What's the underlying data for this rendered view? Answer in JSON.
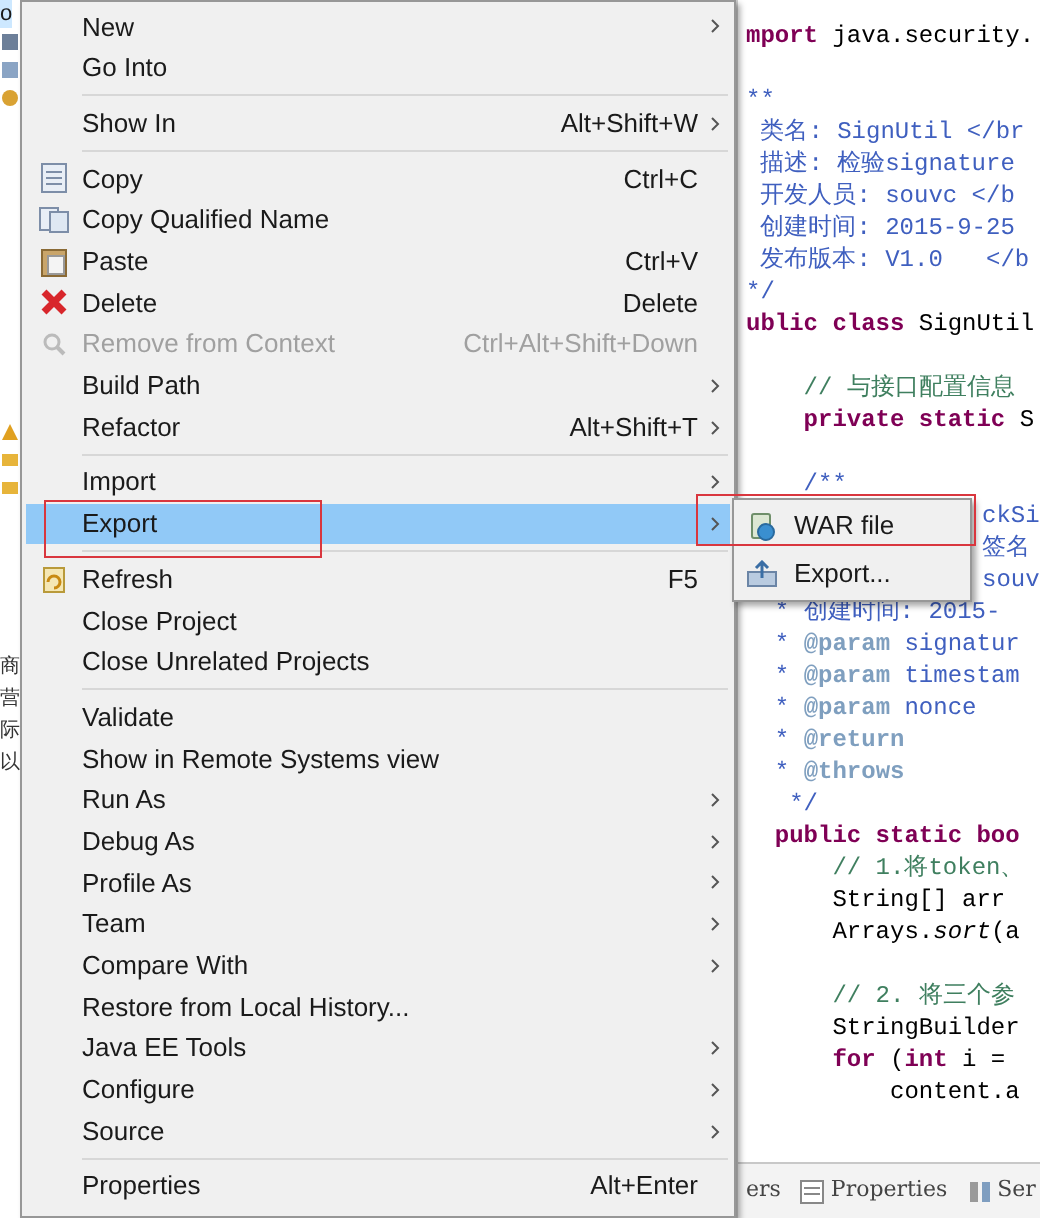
{
  "explorer": {
    "project": "o",
    "side_texts": [
      "商",
      "营",
      "际",
      "以"
    ]
  },
  "context_menu": {
    "groups": [
      [
        {
          "label": "New",
          "submenu": true,
          "disabled": false,
          "selected": false
        },
        {
          "label": "Go Into",
          "submenu": false,
          "disabled": false,
          "selected": false
        }
      ],
      [
        {
          "label": "Show In",
          "shortcut": "Alt+Shift+W",
          "submenu": true,
          "disabled": false,
          "selected": false
        }
      ],
      [
        {
          "label": "Copy",
          "shortcut": "Ctrl+C",
          "submenu": false,
          "disabled": false,
          "selected": false
        },
        {
          "label": "Copy Qualified Name",
          "submenu": false,
          "disabled": false,
          "selected": false
        },
        {
          "label": "Paste",
          "shortcut": "Ctrl+V",
          "submenu": false,
          "disabled": false,
          "selected": false
        },
        {
          "label": "Delete",
          "shortcut": "Delete",
          "submenu": false,
          "disabled": false,
          "selected": false
        },
        {
          "label": "Remove from Context",
          "shortcut": "Ctrl+Alt+Shift+Down",
          "submenu": false,
          "disabled": true,
          "selected": false
        },
        {
          "label": "Build Path",
          "submenu": true,
          "disabled": false,
          "selected": false
        },
        {
          "label": "Refactor",
          "shortcut": "Alt+Shift+T",
          "submenu": true,
          "disabled": false,
          "selected": false
        }
      ],
      [
        {
          "label": "Import",
          "submenu": true,
          "disabled": false,
          "selected": false
        },
        {
          "label": "Export",
          "submenu": true,
          "disabled": false,
          "selected": true
        }
      ],
      [
        {
          "label": "Refresh",
          "shortcut": "F5",
          "submenu": false,
          "disabled": false,
          "selected": false
        },
        {
          "label": "Close Project",
          "submenu": false,
          "disabled": false,
          "selected": false
        },
        {
          "label": "Close Unrelated Projects",
          "submenu": false,
          "disabled": false,
          "selected": false
        }
      ],
      [
        {
          "label": "Validate",
          "submenu": false,
          "disabled": false,
          "selected": false
        },
        {
          "label": "Show in Remote Systems view",
          "submenu": false,
          "disabled": false,
          "selected": false
        },
        {
          "label": "Run As",
          "submenu": true,
          "disabled": false,
          "selected": false
        },
        {
          "label": "Debug As",
          "submenu": true,
          "disabled": false,
          "selected": false
        },
        {
          "label": "Profile As",
          "submenu": true,
          "disabled": false,
          "selected": false
        },
        {
          "label": "Team",
          "submenu": true,
          "disabled": false,
          "selected": false
        },
        {
          "label": "Compare With",
          "submenu": true,
          "disabled": false,
          "selected": false
        },
        {
          "label": "Restore from Local History...",
          "submenu": false,
          "disabled": false,
          "selected": false
        },
        {
          "label": "Java EE Tools",
          "submenu": true,
          "disabled": false,
          "selected": false
        },
        {
          "label": "Configure",
          "submenu": true,
          "disabled": false,
          "selected": false
        },
        {
          "label": "Source",
          "submenu": true,
          "disabled": false,
          "selected": false
        }
      ],
      [
        {
          "label": "Properties",
          "shortcut": "Alt+Enter",
          "submenu": false,
          "disabled": false,
          "selected": false
        }
      ]
    ]
  },
  "export_submenu": [
    {
      "label": "WAR file"
    },
    {
      "label": "Export..."
    }
  ],
  "editor": {
    "lines": [
      {
        "kind": "code",
        "tokens": [
          {
            "text": "mport ",
            "kind": "kw"
          },
          {
            "text": "java.security.",
            "kind": "plain"
          }
        ]
      },
      {
        "kind": "blank"
      },
      {
        "kind": "code",
        "tokens": [
          {
            "text": "**",
            "kind": "doc"
          }
        ]
      },
      {
        "kind": "code",
        "tokens": [
          {
            "text": " 类名: SignUtil </br",
            "kind": "doc"
          }
        ]
      },
      {
        "kind": "code",
        "tokens": [
          {
            "text": " 描述: 检验signature",
            "kind": "doc"
          }
        ]
      },
      {
        "kind": "code",
        "tokens": [
          {
            "text": " 开发人员: souvc </b",
            "kind": "doc"
          }
        ]
      },
      {
        "kind": "code",
        "tokens": [
          {
            "text": " 创建时间: 2015-9-25",
            "kind": "doc"
          }
        ]
      },
      {
        "kind": "code",
        "tokens": [
          {
            "text": " 发布版本: V1.0   </b",
            "kind": "doc"
          }
        ]
      },
      {
        "kind": "code",
        "tokens": [
          {
            "text": "*/",
            "kind": "doc"
          }
        ]
      },
      {
        "kind": "code",
        "tokens": [
          {
            "text": "ublic class ",
            "kind": "kw"
          },
          {
            "text": "SignUtil",
            "kind": "plain"
          }
        ]
      },
      {
        "kind": "blank"
      },
      {
        "kind": "code",
        "tokens": [
          {
            "text": "    // 与接口配置信息",
            "kind": "comment"
          }
        ]
      },
      {
        "kind": "code",
        "tokens": [
          {
            "text": "    private static ",
            "kind": "kw"
          },
          {
            "text": "S",
            "kind": "plain"
          }
        ]
      },
      {
        "kind": "blank"
      },
      {
        "kind": "code",
        "tokens": [
          {
            "text": "    /**",
            "kind": "doc"
          }
        ]
      },
      {
        "kind": "covered",
        "tokens": [
          {
            "text": "ckSi",
            "kind": "doc"
          }
        ]
      },
      {
        "kind": "covered",
        "tokens": [
          {
            "text": "签名",
            "kind": "doc"
          }
        ]
      },
      {
        "kind": "covered",
        "tokens": [
          {
            "text": "souv",
            "kind": "doc"
          }
        ]
      },
      {
        "kind": "code",
        "tokens": [
          {
            "text": "  * 创建时间: 2015-",
            "kind": "doc"
          }
        ]
      },
      {
        "kind": "code",
        "tokens": [
          {
            "text": "  * ",
            "kind": "doc"
          },
          {
            "text": "@param",
            "kind": "tag"
          },
          {
            "text": " signatur",
            "kind": "doc"
          }
        ]
      },
      {
        "kind": "code",
        "tokens": [
          {
            "text": "  * ",
            "kind": "doc"
          },
          {
            "text": "@param",
            "kind": "tag"
          },
          {
            "text": " timestam",
            "kind": "doc"
          }
        ]
      },
      {
        "kind": "code",
        "tokens": [
          {
            "text": "  * ",
            "kind": "doc"
          },
          {
            "text": "@param",
            "kind": "tag"
          },
          {
            "text": " nonce",
            "kind": "doc"
          }
        ]
      },
      {
        "kind": "code",
        "tokens": [
          {
            "text": "  * ",
            "kind": "doc"
          },
          {
            "text": "@return",
            "kind": "tag"
          }
        ]
      },
      {
        "kind": "code",
        "tokens": [
          {
            "text": "  * ",
            "kind": "doc"
          },
          {
            "text": "@throws",
            "kind": "tag"
          }
        ]
      },
      {
        "kind": "code",
        "tokens": [
          {
            "text": "   */",
            "kind": "doc"
          }
        ]
      },
      {
        "kind": "code",
        "tokens": [
          {
            "text": "  public static ",
            "kind": "kw"
          },
          {
            "text": "boo",
            "kind": "kw"
          }
        ]
      },
      {
        "kind": "code",
        "tokens": [
          {
            "text": "      // 1.将token、",
            "kind": "comment"
          }
        ]
      },
      {
        "kind": "code",
        "tokens": [
          {
            "text": "      String[] arr",
            "kind": "plain"
          }
        ]
      },
      {
        "kind": "code",
        "tokens": [
          {
            "text": "      Arrays.",
            "kind": "plain"
          },
          {
            "text": "sort",
            "kind": "italic"
          },
          {
            "text": "(a",
            "kind": "plain"
          }
        ]
      },
      {
        "kind": "blank"
      },
      {
        "kind": "code",
        "tokens": [
          {
            "text": "      // 2. 将三个参",
            "kind": "comment"
          }
        ]
      },
      {
        "kind": "code",
        "tokens": [
          {
            "text": "      StringBuilder",
            "kind": "plain"
          }
        ]
      },
      {
        "kind": "code",
        "tokens": [
          {
            "text": "      for",
            "kind": "kw"
          },
          {
            "text": " (",
            "kind": "plain"
          },
          {
            "text": "int",
            "kind": "kw"
          },
          {
            "text": " i =",
            "kind": "plain"
          }
        ]
      },
      {
        "kind": "code",
        "tokens": [
          {
            "text": "          content.a",
            "kind": "plain"
          }
        ]
      }
    ]
  },
  "bottom_tabs": [
    {
      "label": "ers"
    },
    {
      "label": "Properties"
    },
    {
      "label": "Ser"
    }
  ]
}
